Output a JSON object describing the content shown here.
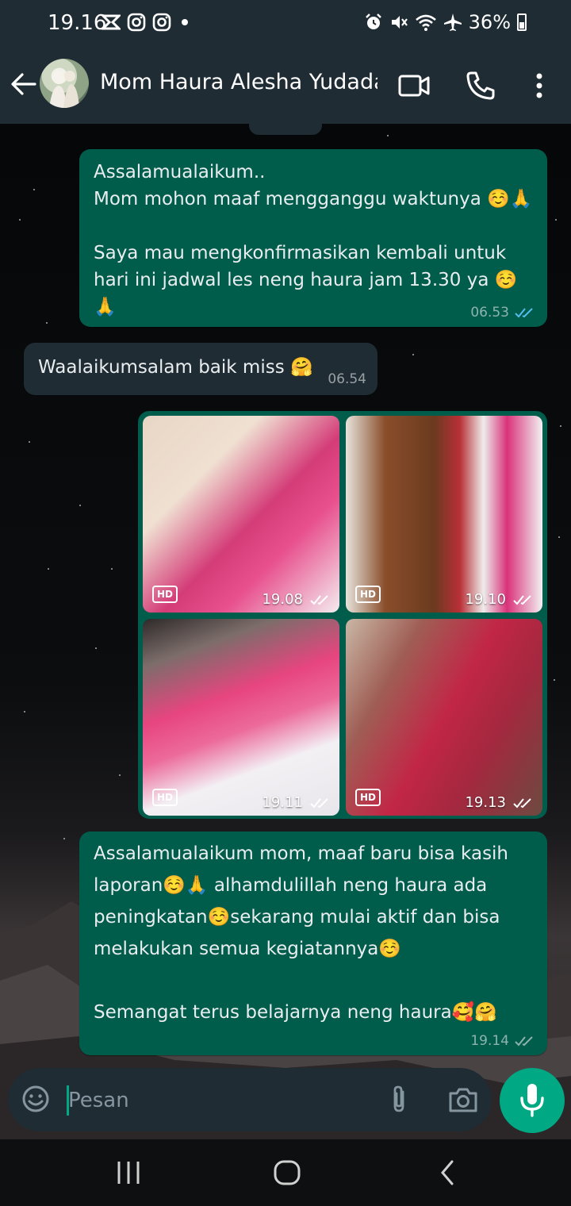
{
  "status_bar": {
    "time": "19.16",
    "battery": "36%",
    "left_icons": [
      "missed-call-icon",
      "instagram-icon",
      "instagram-icon",
      "dot-icon"
    ],
    "right_icons": [
      "alarm-icon",
      "mute-icon",
      "wifi-icon",
      "airplane-icon",
      "battery-icon"
    ]
  },
  "header": {
    "contact_name": "Mom Haura Alesha Yudadar..."
  },
  "messages": [
    {
      "direction": "out",
      "text": "Assalamualaikum..\nMom mohon maaf mengganggu waktunya ☺️🙏\n\nSaya mau mengkonfirmasikan kembali untuk hari ini jadwal les neng haura jam 13.30 ya ☺️🙏",
      "time": "06.53",
      "status": "read"
    },
    {
      "direction": "in",
      "text": "Waalaikumsalam baik miss 🤗",
      "time": "06.54"
    },
    {
      "direction": "out",
      "type": "media_group",
      "items": [
        {
          "badge": "HD",
          "time": "19.08",
          "status": "delivered"
        },
        {
          "badge": "HD",
          "time": "19.10",
          "status": "delivered"
        },
        {
          "badge": "HD",
          "time": "19.11",
          "status": "delivered"
        },
        {
          "badge": "HD",
          "time": "19.13",
          "status": "delivered"
        }
      ]
    },
    {
      "direction": "out",
      "text": "Assalamualaikum mom, maaf baru bisa kasih laporan☺️🙏 alhamdulillah neng haura ada peningkatan☺️sekarang mulai aktif dan bisa melakukan semua kegiatannya☺️\n\nSemangat terus belajarnya neng haura🥰🤗",
      "time": "19.14",
      "status": "delivered"
    }
  ],
  "composer": {
    "placeholder": "Pesan"
  },
  "colors": {
    "outgoing_bubble": "#005c4b",
    "incoming_bubble": "#1f2c34",
    "accent": "#00a884",
    "read_tick": "#53bdeb"
  }
}
